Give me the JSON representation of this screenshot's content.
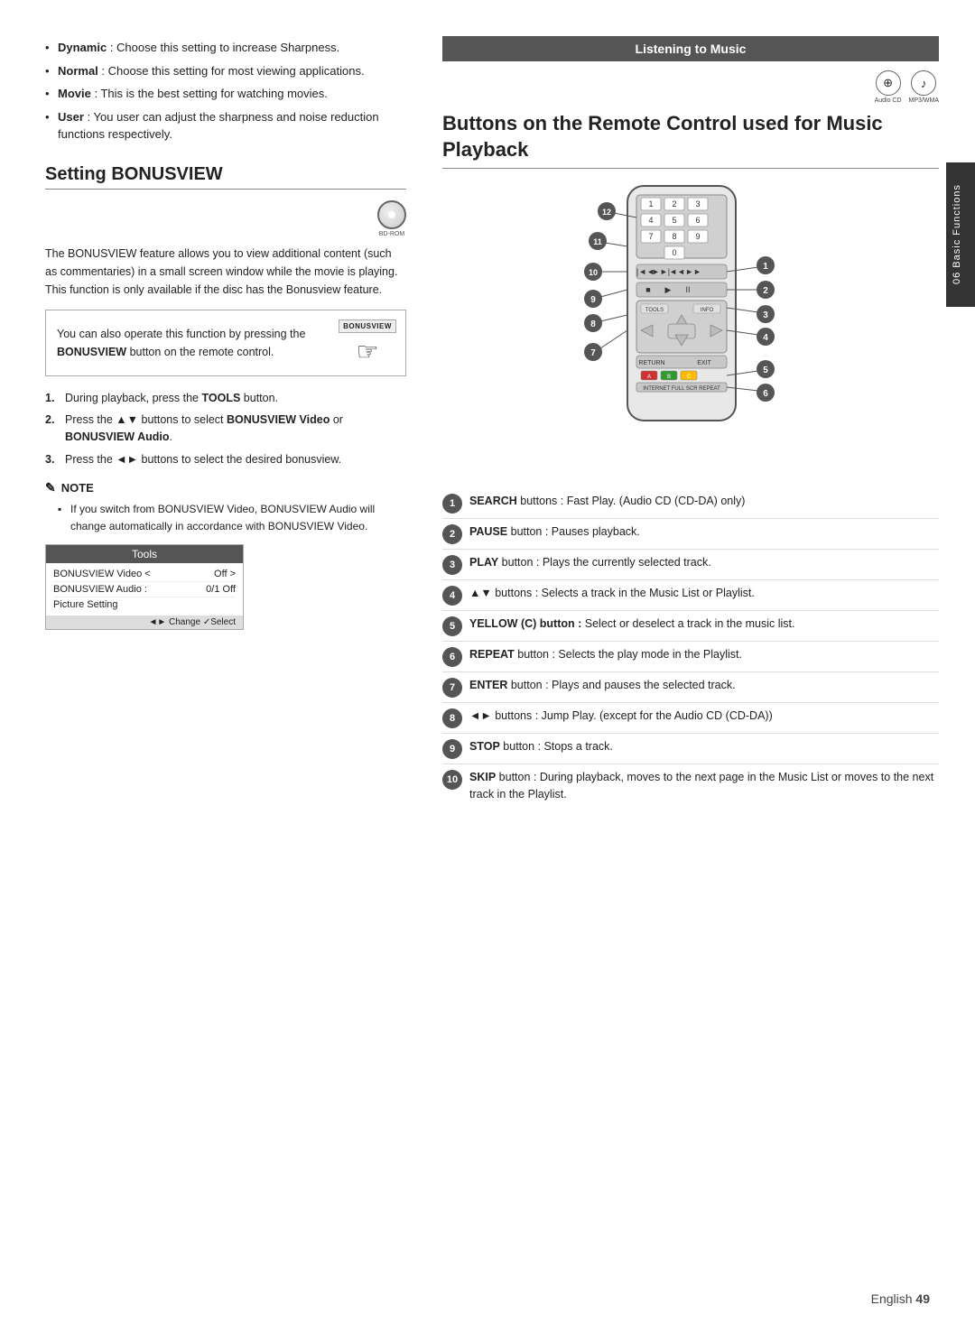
{
  "page": {
    "number": "49",
    "language": "English"
  },
  "side_tab": {
    "label": "06 Basic Functions"
  },
  "left_column": {
    "bullets": [
      {
        "term": "Dynamic",
        "text": ": Choose this setting to increase Sharpness."
      },
      {
        "term": "Normal",
        "text": ": Choose this setting for most viewing applications."
      },
      {
        "term": "Movie",
        "text": ": This is the best setting for watching movies."
      },
      {
        "term": "User",
        "text": ": You user can adjust the sharpness and noise reduction functions respectively."
      }
    ],
    "section_title": "Setting BONUSVIEW",
    "disc_label": "BD-ROM",
    "body_text": "The BONUSVIEW feature allows you to view additional content (such as commentaries) in a small screen window while the movie is playing. This function is only available if the disc has the Bonusview feature.",
    "bonusview_box": {
      "text_before": "You can also operate this function by pressing the ",
      "bold_text": "BONUSVIEW",
      "text_after": " button on the remote control.",
      "btn_label": "BONUSVIEW"
    },
    "steps": [
      {
        "num": "1.",
        "text": "During playback, press the ",
        "bold": "TOOLS",
        "text_after": " button."
      },
      {
        "num": "2.",
        "text": "Press the ▲▼ buttons to select ",
        "bold1": "BONUSVIEW Video",
        "mid": " or ",
        "bold2": "BONUSVIEW Audio",
        "end": "."
      },
      {
        "num": "3.",
        "text": "Press the ◄► buttons to select the desired bonusview."
      }
    ],
    "note_title": "NOTE",
    "note_items": [
      "If you switch from BONUSVIEW Video, BONUSVIEW Audio will change automatically in accordance with BONUSVIEW Video."
    ],
    "tools_menu": {
      "title": "Tools",
      "rows": [
        {
          "label": "BONUSVIEW Video <",
          "value": "Off >"
        },
        {
          "label": "BONUSVIEW Audio :",
          "value": "0/1 Off"
        },
        {
          "label": "Picture Setting",
          "value": ""
        }
      ],
      "footer": "◄► Change  ✓Select"
    }
  },
  "right_column": {
    "header_bar": "Listening to Music",
    "section_title": "Buttons on the Remote Control used for Music Playback",
    "audio_icons": [
      {
        "symbol": "⊕",
        "label": "Audio CD"
      },
      {
        "symbol": "♪",
        "label": "MP3/WMA"
      }
    ],
    "descriptions": [
      {
        "num": "1",
        "bold": "SEARCH",
        "text": " buttons : Fast Play. (Audio CD (CD-DA) only)"
      },
      {
        "num": "2",
        "bold": "PAUSE",
        "text": " button : Pauses playback."
      },
      {
        "num": "3",
        "bold": "PLAY",
        "text": " button : Plays the currently selected track."
      },
      {
        "num": "4",
        "bold": "▲▼",
        "text": " buttons : Selects a track in the Music List or Playlist."
      },
      {
        "num": "5",
        "bold": "YELLOW (C)",
        "text": " button : Select or deselect a track in the music list."
      },
      {
        "num": "6",
        "bold": "REPEAT",
        "text": " button : Selects the play mode in the Playlist."
      },
      {
        "num": "7",
        "bold": "ENTER",
        "text": " button : Plays and pauses the selected track."
      },
      {
        "num": "8",
        "bold": "◄►",
        "text": " buttons : Jump Play. (except for the Audio CD (CD-DA))"
      },
      {
        "num": "9",
        "bold": "STOP",
        "text": " button : Stops a track."
      },
      {
        "num": "10",
        "bold": "SKIP",
        "text": " button : During playback, moves to the next page in the Music List or moves to the next track in the Playlist."
      }
    ],
    "callout_labels": [
      "1",
      "2",
      "3",
      "4",
      "5",
      "6",
      "7",
      "8",
      "9",
      "10",
      "11",
      "12"
    ]
  }
}
